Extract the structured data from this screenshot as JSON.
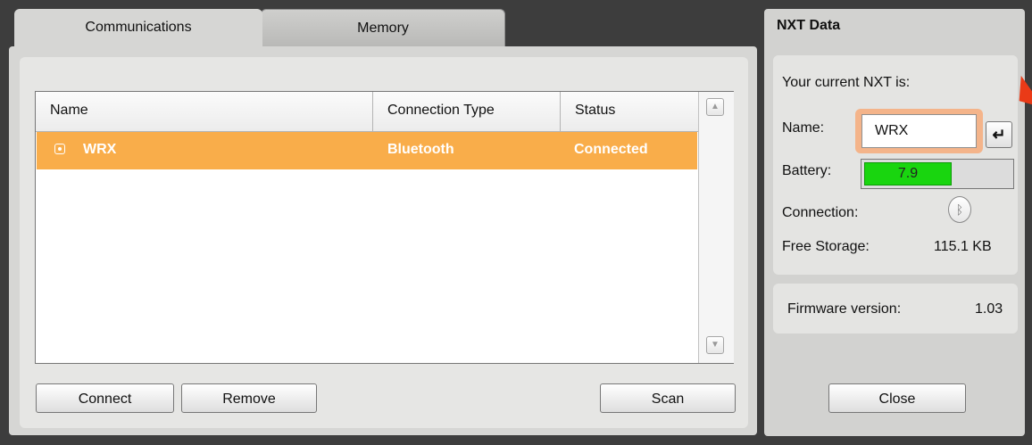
{
  "tabs": [
    {
      "label": "Communications",
      "active": true
    },
    {
      "label": "Memory",
      "active": false
    }
  ],
  "table": {
    "columns": [
      "Name",
      "Connection Type",
      "Status"
    ],
    "rows": [
      {
        "name": "WRX",
        "connection_type": "Bluetooth",
        "status": "Connected",
        "selected": true
      }
    ]
  },
  "buttons": {
    "connect": "Connect",
    "remove": "Remove",
    "scan": "Scan",
    "close": "Close"
  },
  "nxt_data": {
    "title": "NXT Data",
    "current_label": "Your current NXT is:",
    "name_label": "Name:",
    "name_value": "WRX",
    "enter_glyph": "↵",
    "battery_label": "Battery:",
    "battery_value": "7.9",
    "battery_fraction": 0.6,
    "connection_label": "Connection:",
    "connection_icon": "bluetooth-icon",
    "storage_label": "Free Storage:",
    "storage_value": "115.1 KB",
    "firmware_label": "Firmware version:",
    "firmware_value": "1.03"
  },
  "colors": {
    "selection": "#f9ad4a",
    "battery": "#19d50f",
    "focus_ring": "#f4b48a",
    "arrow": "#ea3a17"
  }
}
